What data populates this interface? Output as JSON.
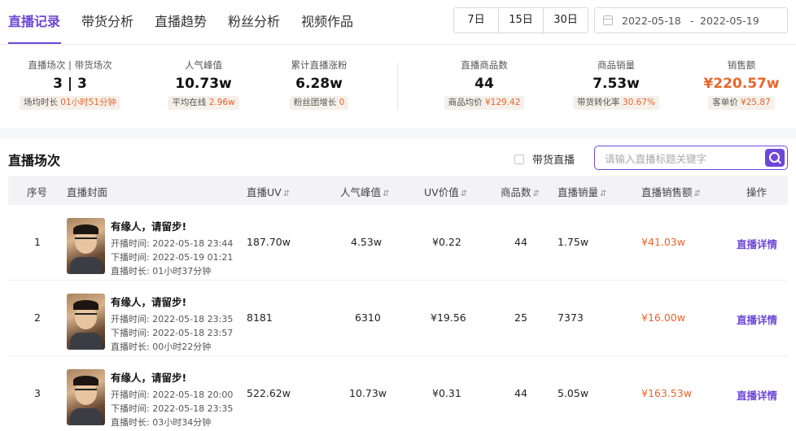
{
  "tabs": [
    "直播记录",
    "带货分析",
    "直播趋势",
    "粉丝分析",
    "视频作品"
  ],
  "range_buttons": [
    "7日",
    "15日",
    "30日"
  ],
  "date_range": {
    "start": "2022-05-18",
    "separator": "-",
    "end": "2022-05-19"
  },
  "stats": [
    {
      "label": "直播场次 | 带货场次",
      "value": "3 | 3",
      "sub_label": "场均时长",
      "sub_value": "01小时51分钟"
    },
    {
      "label": "人气峰值",
      "value": "10.73w",
      "sub_label": "平均在线",
      "sub_value": "2.96w"
    },
    {
      "label": "累计直播涨粉",
      "value": "6.28w",
      "sub_label": "粉丝团增长",
      "sub_value": "0"
    },
    {
      "label": "直播商品数",
      "value": "44",
      "sub_label": "商品均价",
      "sub_value": "¥129.42"
    },
    {
      "label": "商品销量",
      "value": "7.53w",
      "sub_label": "带货转化率",
      "sub_value": "30.67%"
    },
    {
      "label": "销售额",
      "value": "¥220.57w",
      "sub_label": "客单价",
      "sub_value": "¥25.87",
      "value_color": "#e8652b"
    }
  ],
  "panel": {
    "title": "直播场次",
    "checkbox_label": "带货直播",
    "search_placeholder": "请输入直播标题关键字"
  },
  "table": {
    "columns": [
      "序号",
      "直播封面",
      "直播UV",
      "人气峰值",
      "UV价值",
      "商品数",
      "直播销量",
      "直播销售额",
      "操作"
    ],
    "sort_icon": "⇵",
    "rows": [
      {
        "index": "1",
        "title": "有缘人，请留步!",
        "start": "开播时间: 2022-05-18 23:44",
        "end": "下播时间: 2022-05-19 01:21",
        "duration": "直播时长: 01小时37分钟",
        "uv": "187.70w",
        "peak": "4.53w",
        "uv_value": "¥0.22",
        "goods": "44",
        "sales": "1.75w",
        "revenue": "¥41.03w",
        "action": "直播详情"
      },
      {
        "index": "2",
        "title": "有缘人，请留步!",
        "start": "开播时间: 2022-05-18 23:35",
        "end": "下播时间: 2022-05-18 23:57",
        "duration": "直播时长: 00小时22分钟",
        "uv": "8181",
        "peak": "6310",
        "uv_value": "¥19.56",
        "goods": "25",
        "sales": "7373",
        "revenue": "¥16.00w",
        "action": "直播详情"
      },
      {
        "index": "3",
        "title": "有缘人，请留步!",
        "start": "开播时间: 2022-05-18 20:00",
        "end": "下播时间: 2022-05-18 23:35",
        "duration": "直播时长: 03小时34分钟",
        "uv": "522.62w",
        "peak": "10.73w",
        "uv_value": "¥0.31",
        "goods": "44",
        "sales": "5.05w",
        "revenue": "¥163.53w",
        "action": "直播详情"
      }
    ]
  },
  "colors": {
    "accent": "#6e47d8",
    "price": "#e8652b"
  }
}
